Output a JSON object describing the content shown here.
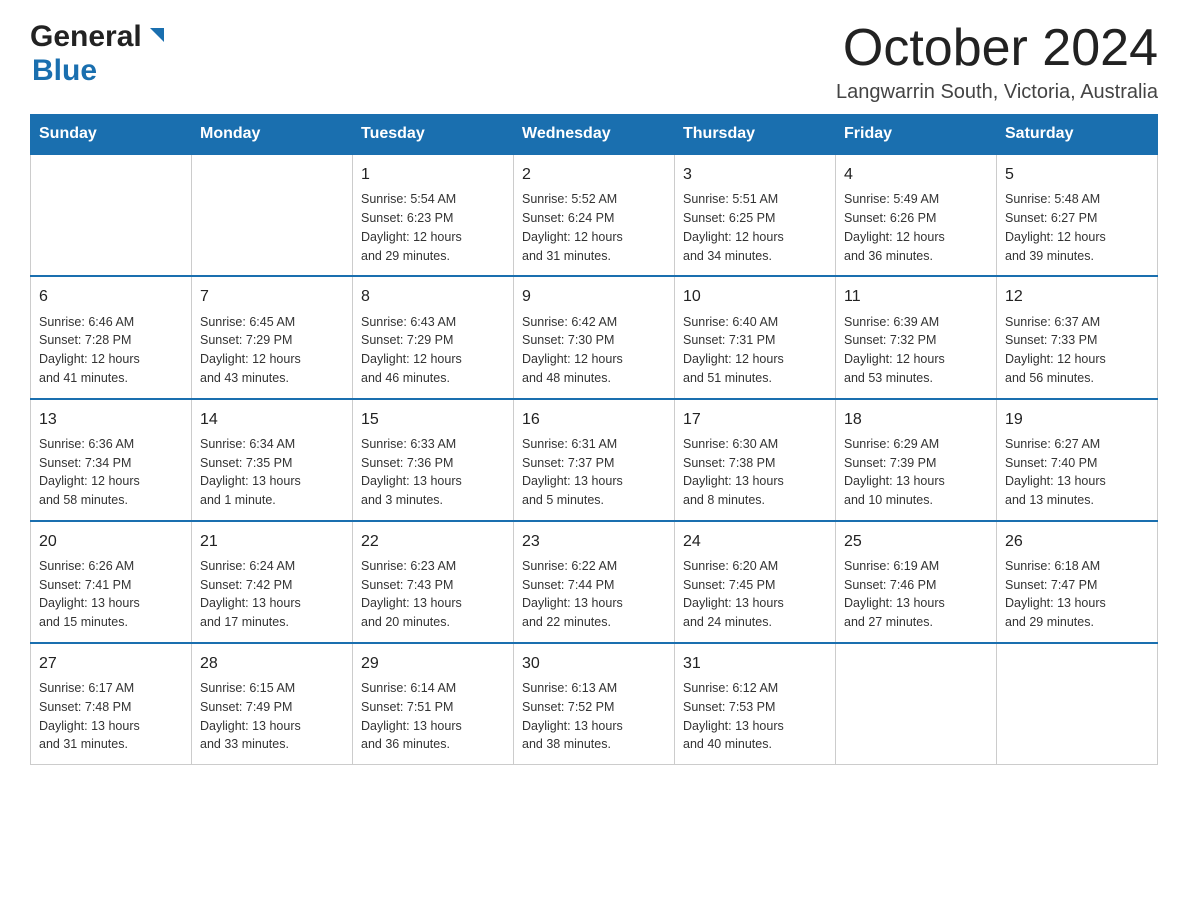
{
  "header": {
    "month": "October 2024",
    "location": "Langwarrin South, Victoria, Australia"
  },
  "logo": {
    "line1": "General",
    "line2": "Blue"
  },
  "weekdays": [
    "Sunday",
    "Monday",
    "Tuesday",
    "Wednesday",
    "Thursday",
    "Friday",
    "Saturday"
  ],
  "weeks": [
    [
      {
        "day": "",
        "info": ""
      },
      {
        "day": "",
        "info": ""
      },
      {
        "day": "1",
        "info": "Sunrise: 5:54 AM\nSunset: 6:23 PM\nDaylight: 12 hours\nand 29 minutes."
      },
      {
        "day": "2",
        "info": "Sunrise: 5:52 AM\nSunset: 6:24 PM\nDaylight: 12 hours\nand 31 minutes."
      },
      {
        "day": "3",
        "info": "Sunrise: 5:51 AM\nSunset: 6:25 PM\nDaylight: 12 hours\nand 34 minutes."
      },
      {
        "day": "4",
        "info": "Sunrise: 5:49 AM\nSunset: 6:26 PM\nDaylight: 12 hours\nand 36 minutes."
      },
      {
        "day": "5",
        "info": "Sunrise: 5:48 AM\nSunset: 6:27 PM\nDaylight: 12 hours\nand 39 minutes."
      }
    ],
    [
      {
        "day": "6",
        "info": "Sunrise: 6:46 AM\nSunset: 7:28 PM\nDaylight: 12 hours\nand 41 minutes."
      },
      {
        "day": "7",
        "info": "Sunrise: 6:45 AM\nSunset: 7:29 PM\nDaylight: 12 hours\nand 43 minutes."
      },
      {
        "day": "8",
        "info": "Sunrise: 6:43 AM\nSunset: 7:29 PM\nDaylight: 12 hours\nand 46 minutes."
      },
      {
        "day": "9",
        "info": "Sunrise: 6:42 AM\nSunset: 7:30 PM\nDaylight: 12 hours\nand 48 minutes."
      },
      {
        "day": "10",
        "info": "Sunrise: 6:40 AM\nSunset: 7:31 PM\nDaylight: 12 hours\nand 51 minutes."
      },
      {
        "day": "11",
        "info": "Sunrise: 6:39 AM\nSunset: 7:32 PM\nDaylight: 12 hours\nand 53 minutes."
      },
      {
        "day": "12",
        "info": "Sunrise: 6:37 AM\nSunset: 7:33 PM\nDaylight: 12 hours\nand 56 minutes."
      }
    ],
    [
      {
        "day": "13",
        "info": "Sunrise: 6:36 AM\nSunset: 7:34 PM\nDaylight: 12 hours\nand 58 minutes."
      },
      {
        "day": "14",
        "info": "Sunrise: 6:34 AM\nSunset: 7:35 PM\nDaylight: 13 hours\nand 1 minute."
      },
      {
        "day": "15",
        "info": "Sunrise: 6:33 AM\nSunset: 7:36 PM\nDaylight: 13 hours\nand 3 minutes."
      },
      {
        "day": "16",
        "info": "Sunrise: 6:31 AM\nSunset: 7:37 PM\nDaylight: 13 hours\nand 5 minutes."
      },
      {
        "day": "17",
        "info": "Sunrise: 6:30 AM\nSunset: 7:38 PM\nDaylight: 13 hours\nand 8 minutes."
      },
      {
        "day": "18",
        "info": "Sunrise: 6:29 AM\nSunset: 7:39 PM\nDaylight: 13 hours\nand 10 minutes."
      },
      {
        "day": "19",
        "info": "Sunrise: 6:27 AM\nSunset: 7:40 PM\nDaylight: 13 hours\nand 13 minutes."
      }
    ],
    [
      {
        "day": "20",
        "info": "Sunrise: 6:26 AM\nSunset: 7:41 PM\nDaylight: 13 hours\nand 15 minutes."
      },
      {
        "day": "21",
        "info": "Sunrise: 6:24 AM\nSunset: 7:42 PM\nDaylight: 13 hours\nand 17 minutes."
      },
      {
        "day": "22",
        "info": "Sunrise: 6:23 AM\nSunset: 7:43 PM\nDaylight: 13 hours\nand 20 minutes."
      },
      {
        "day": "23",
        "info": "Sunrise: 6:22 AM\nSunset: 7:44 PM\nDaylight: 13 hours\nand 22 minutes."
      },
      {
        "day": "24",
        "info": "Sunrise: 6:20 AM\nSunset: 7:45 PM\nDaylight: 13 hours\nand 24 minutes."
      },
      {
        "day": "25",
        "info": "Sunrise: 6:19 AM\nSunset: 7:46 PM\nDaylight: 13 hours\nand 27 minutes."
      },
      {
        "day": "26",
        "info": "Sunrise: 6:18 AM\nSunset: 7:47 PM\nDaylight: 13 hours\nand 29 minutes."
      }
    ],
    [
      {
        "day": "27",
        "info": "Sunrise: 6:17 AM\nSunset: 7:48 PM\nDaylight: 13 hours\nand 31 minutes."
      },
      {
        "day": "28",
        "info": "Sunrise: 6:15 AM\nSunset: 7:49 PM\nDaylight: 13 hours\nand 33 minutes."
      },
      {
        "day": "29",
        "info": "Sunrise: 6:14 AM\nSunset: 7:51 PM\nDaylight: 13 hours\nand 36 minutes."
      },
      {
        "day": "30",
        "info": "Sunrise: 6:13 AM\nSunset: 7:52 PM\nDaylight: 13 hours\nand 38 minutes."
      },
      {
        "day": "31",
        "info": "Sunrise: 6:12 AM\nSunset: 7:53 PM\nDaylight: 13 hours\nand 40 minutes."
      },
      {
        "day": "",
        "info": ""
      },
      {
        "day": "",
        "info": ""
      }
    ]
  ]
}
